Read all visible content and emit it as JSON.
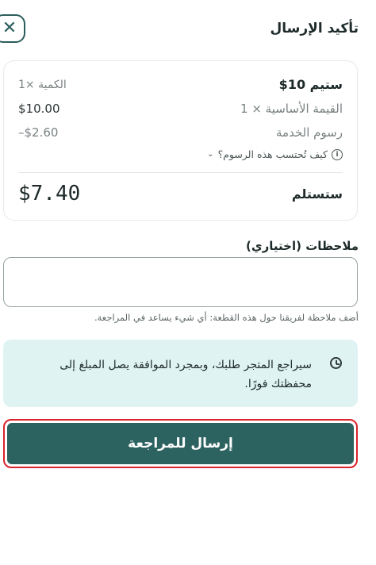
{
  "header": {
    "title": "تأكيد الإرسال",
    "close_icon": "close-icon"
  },
  "summary": {
    "item_name": "ستيم 10$",
    "quantity": "الكمية ×1",
    "base_label": "القيمة الأساسية × 1",
    "base_value": "$10.00",
    "fee_label": "رسوم الخدمة",
    "fee_value": "–$2.60",
    "how_calculated": "كيف تُحتسب هذه الرسوم؟",
    "receive_label": "ستستلم",
    "receive_value": "$7.40"
  },
  "notes": {
    "label": "ملاحظات (اختياري)",
    "value": "",
    "placeholder": "",
    "hint": "أضف ملاحظة لفريقنا حول هذه القطعة: أي شيء يساعد في المراجعة."
  },
  "banner": {
    "icon": "clock-check-icon",
    "text": "سيراجع المتجر طلبك، وبمجرد الموافقة يصل المبلغ إلى محفظتك فورًا."
  },
  "submit": {
    "label": "إرسال للمراجعة"
  },
  "colors": {
    "accent": "#2c6361",
    "highlight_border": "#d9232d",
    "banner_bg": "#dff3f3"
  }
}
